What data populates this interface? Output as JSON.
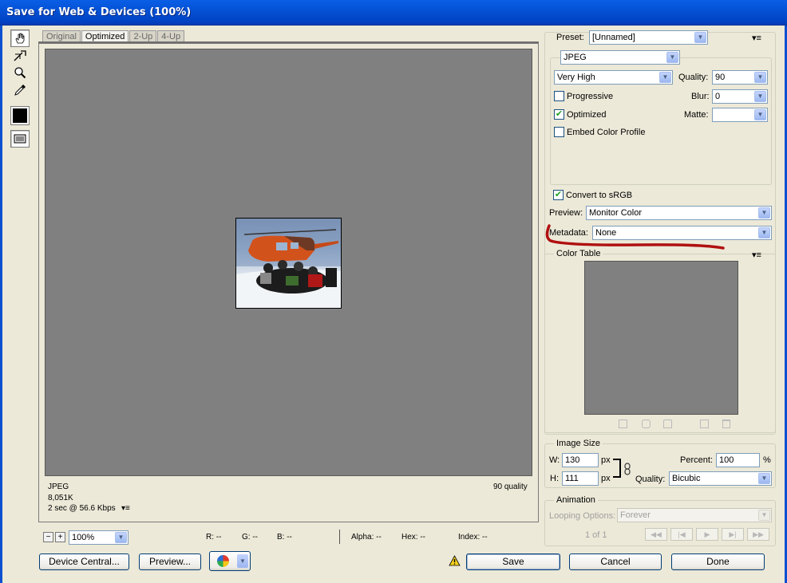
{
  "window": {
    "title": "Save for Web & Devices (100%)"
  },
  "tools": [
    {
      "name": "hand-tool-icon",
      "symbol": "✋"
    },
    {
      "name": "slice-select-tool-icon",
      "symbol": "↖"
    },
    {
      "name": "zoom-tool-icon",
      "symbol": "🔍"
    },
    {
      "name": "eyedropper-tool-icon",
      "symbol": "✎"
    },
    {
      "name": "toggle-slices-icon",
      "symbol": "▭"
    }
  ],
  "tabs": [
    "Original",
    "Optimized",
    "2-Up",
    "4-Up"
  ],
  "active_tab": "Optimized",
  "image_info": {
    "format": "JPEG",
    "size": "8,051K",
    "time": "2 sec @ 56.6 Kbps",
    "quality": "90 quality",
    "menu_glyph": "▾≡"
  },
  "zoom": {
    "minus": "−",
    "plus": "+",
    "value": "100%"
  },
  "readouts": {
    "r": "R: --",
    "g": "G: --",
    "b": "B: --",
    "alpha": "Alpha: --",
    "hex": "Hex: --",
    "index": "Index: --"
  },
  "bottom_buttons": {
    "device_central": "Device Central...",
    "preview": "Preview...",
    "save": "Save",
    "cancel": "Cancel",
    "done": "Done"
  },
  "settings": {
    "preset_label": "Preset:",
    "preset_value": "[Unnamed]",
    "menu_glyph": "▾≡",
    "format": "JPEG",
    "compression": "Very High",
    "quality_label": "Quality:",
    "quality_value": "90",
    "progressive_label": "Progressive",
    "progressive_checked": false,
    "blur_label": "Blur:",
    "blur_value": "0",
    "optimized_label": "Optimized",
    "optimized_checked": true,
    "matte_label": "Matte:",
    "matte_value": "",
    "embed_label": "Embed Color Profile",
    "embed_checked": false,
    "convert_label": "Convert to sRGB",
    "convert_checked": true,
    "preview_label": "Preview:",
    "preview_value": "Monitor Color",
    "metadata_label": "Metadata:",
    "metadata_value": "None"
  },
  "color_table": {
    "title": "Color Table",
    "menu_glyph": "▾≡"
  },
  "image_size": {
    "title": "Image Size",
    "w_label": "W:",
    "w_value": "130",
    "w_unit": "px",
    "h_label": "H:",
    "h_value": "111",
    "h_unit": "px",
    "percent_label": "Percent:",
    "percent_value": "100",
    "percent_unit": "%",
    "quality_label": "Quality:",
    "quality_value": "Bicubic"
  },
  "animation": {
    "title": "Animation",
    "looping_label": "Looping Options:",
    "looping_value": "Forever",
    "frame_counter": "1 of 1"
  },
  "colors": {
    "annotation_red": "#b01010",
    "canvas_gray": "#808080",
    "titlebar_blue": "#0452d6"
  }
}
